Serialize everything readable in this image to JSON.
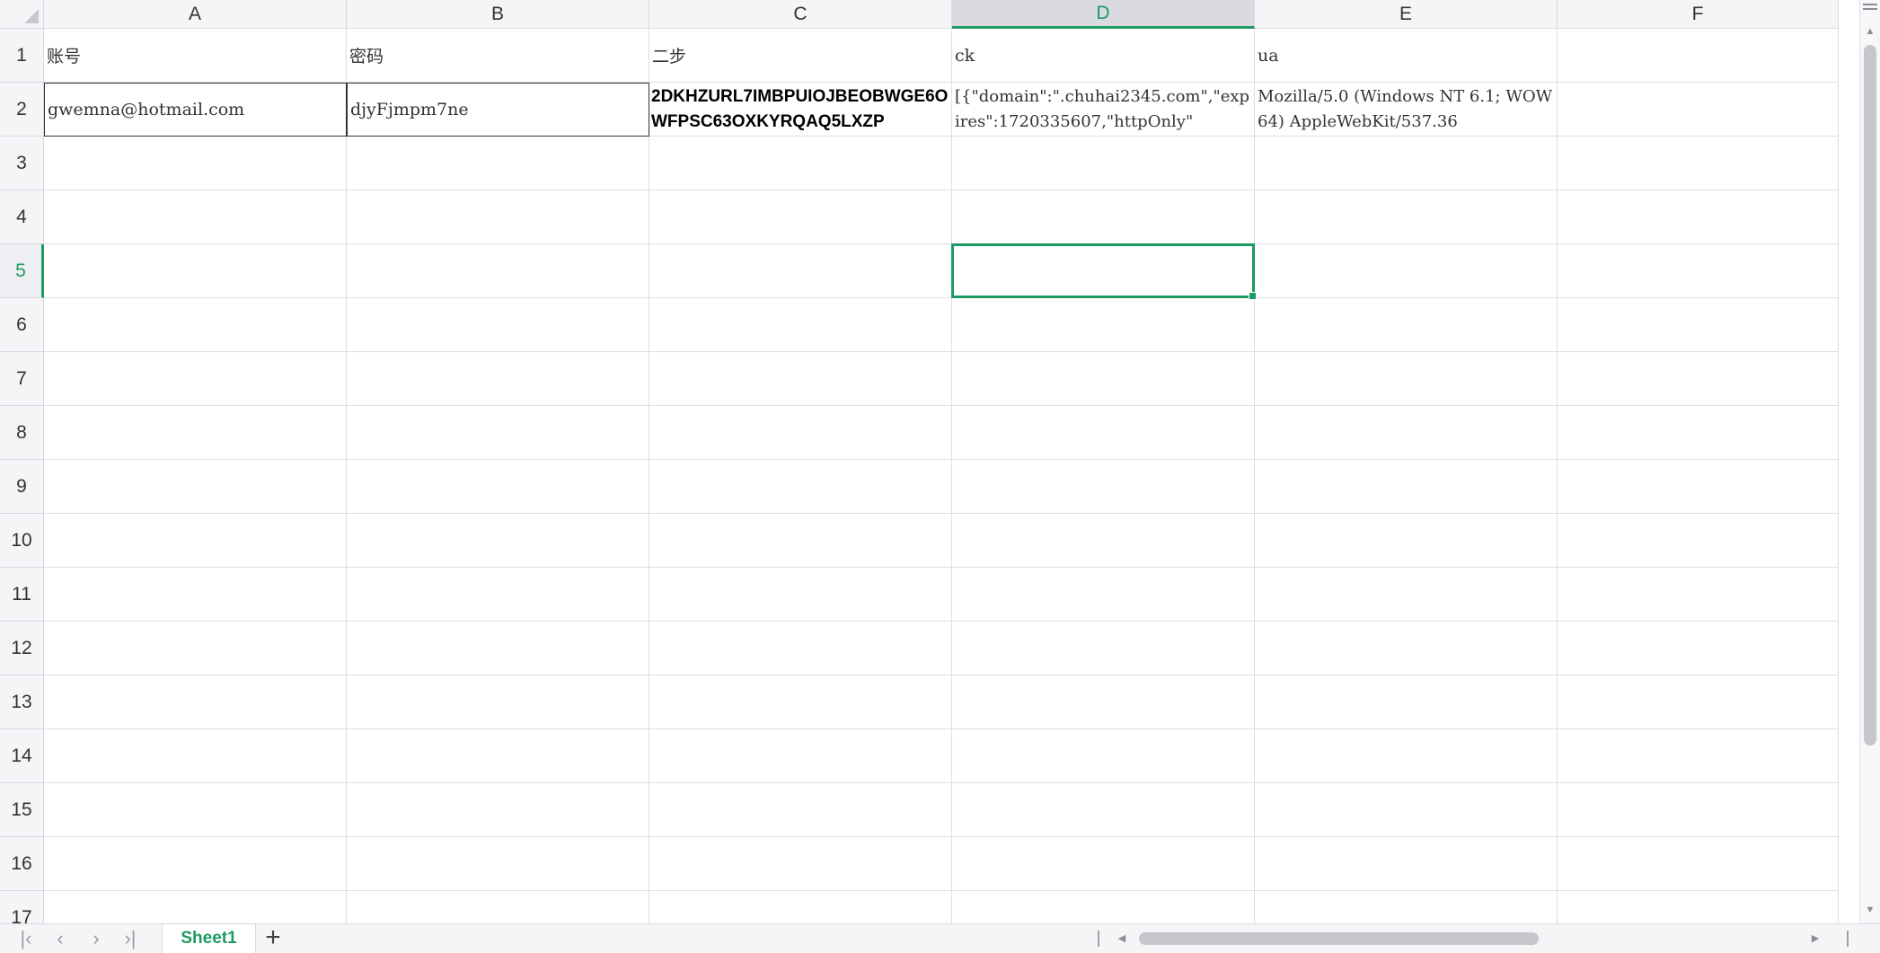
{
  "columns": [
    "A",
    "B",
    "C",
    "D",
    "E",
    "F"
  ],
  "active_column": "D",
  "active_row": "5",
  "rows": [
    "1",
    "2",
    "3",
    "4",
    "5",
    "6",
    "7",
    "8",
    "9",
    "10",
    "11",
    "12",
    "13",
    "14",
    "15",
    "16",
    "17"
  ],
  "cells": {
    "A1": "账号",
    "B1": "密码",
    "C1": "二步",
    "D1": "ck",
    "E1": "ua",
    "A2": "gwemna@hotmail.com",
    "B2": "djyFjmpm7ne",
    "C2": "2DKHZURL7IMBPUIOJBEOBWGE6OWFPSC63OXKYRQAQ5LXZP",
    "D2": "[{\"domain\":\".chuhai2345.com\",\"expires\":1720335607,\"httpOnly\"",
    "E2": "Mozilla/5.0 (Windows NT 6.1; WOW64) AppleWebKit/537.36"
  },
  "sheets": [
    {
      "name": "Sheet1",
      "active": true
    }
  ],
  "icons": {
    "first_sheet": "first-sheet-icon",
    "prev_sheet": "prev-sheet-icon",
    "next_sheet": "next-sheet-icon",
    "last_sheet": "last-sheet-icon",
    "add_sheet": "plus-icon"
  },
  "colors": {
    "accent": "#1e9b62",
    "header_bg": "#f5f5f7",
    "grid_line": "#dcdee6"
  }
}
